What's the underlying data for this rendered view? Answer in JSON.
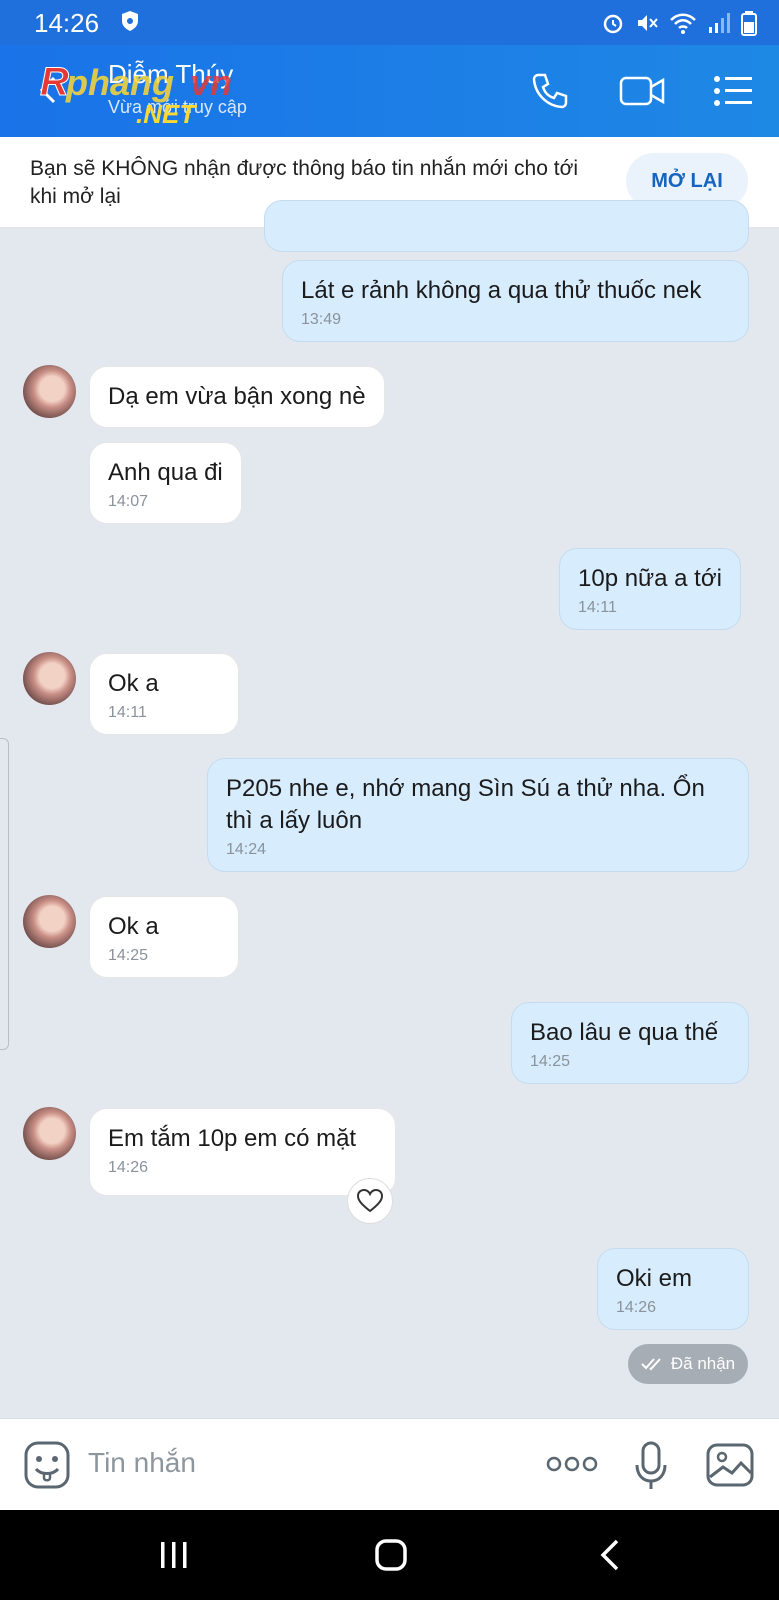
{
  "status_bar": {
    "time": "14:26"
  },
  "header": {
    "contact_name": "Diễm Thúy",
    "contact_status": "Vừa mới truy cập",
    "watermark": "Rphang.vn .NET"
  },
  "banner": {
    "text": "Bạn sẽ KHÔNG nhận được thông báo tin nhắn mới cho tới khi mở lại",
    "button": "MỞ LẠI"
  },
  "messages": [
    {
      "dir": "out",
      "text": "Lát e rảnh không a qua thử thuốc nek",
      "time": "13:49"
    },
    {
      "dir": "in",
      "text": "Dạ em vừa bận xong nè",
      "time": ""
    },
    {
      "dir": "in",
      "text": "Anh qua đi",
      "time": "14:07"
    },
    {
      "dir": "out",
      "text": "10p nữa a tới",
      "time": "14:11"
    },
    {
      "dir": "in",
      "text": "Ok a",
      "time": "14:11"
    },
    {
      "dir": "out",
      "text": "P205 nhe e, nhớ mang Sìn Sú a thử nha. Ổn thì a lấy luôn",
      "time": "14:24"
    },
    {
      "dir": "in",
      "text": "Ok a",
      "time": "14:25"
    },
    {
      "dir": "out",
      "text": "Bao lâu e qua thế",
      "time": "14:25"
    },
    {
      "dir": "in",
      "text": "Em tắm 10p em có mặt",
      "time": "14:26"
    },
    {
      "dir": "out",
      "text": "Oki em",
      "time": "14:26"
    }
  ],
  "delivery_status": "Đã nhận",
  "input": {
    "placeholder": "Tin nhắn"
  },
  "colors": {
    "header": "#1a73e8",
    "outgoing_bubble": "#d7ecfd",
    "incoming_bubble": "#ffffff",
    "background": "#e3e8ee"
  }
}
